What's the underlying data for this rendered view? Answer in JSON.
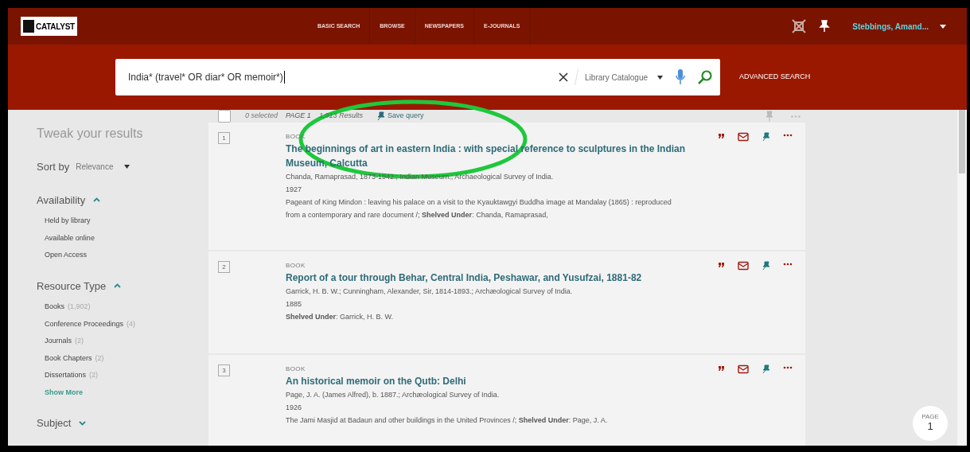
{
  "header": {
    "logo": "CATALYST",
    "nav": [
      {
        "label": "BASIC SEARCH",
        "selected": false
      },
      {
        "label": "BROWSE",
        "selected": false
      },
      {
        "label": "NEWSPAPERS",
        "selected": false
      },
      {
        "label": "E-JOURNALS",
        "selected": false
      }
    ],
    "user": "Stebbings, Amand..."
  },
  "search": {
    "value": "India* (travel* OR diar* OR memoir*)",
    "scope": "Library Catalogue",
    "advanced": "ADVANCED SEARCH"
  },
  "sidebar": {
    "title": "Tweak your results",
    "sort_label": "Sort by",
    "sort_value": "Relevance",
    "facets": [
      {
        "title": "Availability",
        "expanded": true,
        "items": [
          {
            "label": "Held by library"
          },
          {
            "label": "Available online"
          },
          {
            "label": "Open Access"
          }
        ]
      },
      {
        "title": "Resource Type",
        "expanded": true,
        "items": [
          {
            "label": "Books",
            "count": "(1,902)"
          },
          {
            "label": "Conference Proceedings",
            "count": "(4)"
          },
          {
            "label": "Journals",
            "count": "(2)"
          },
          {
            "label": "Book Chapters",
            "count": "(2)"
          },
          {
            "label": "Dissertations",
            "count": "(2)"
          }
        ],
        "show_more": "Show More"
      },
      {
        "title": "Subject",
        "expanded": false
      }
    ]
  },
  "toolbar": {
    "checked": false,
    "selected_label": "0 selected",
    "page_label": "PAGE 1",
    "results_count": "1,913 Results",
    "save_query": "Save query"
  },
  "results": [
    {
      "number": "1",
      "type": "BOOK",
      "title": "The beginnings of art in eastern India : with special reference to sculptures in the Indian Museum, Calcutta",
      "details": [
        "Chanda, Ramaprasad, 1873-1942.; Indian Museum.; Archaeological Survey of India.",
        "1927",
        "Pageant of King Mindon : leaving his palace on a visit to the Kyauktawgyi Buddha image at Mandalay (1865) : reproduced from a contemporary and rare document /; **Shelved Under**: Chanda, Ramaprasad,"
      ]
    },
    {
      "number": "2",
      "type": "BOOK",
      "title": "Report of a tour through Behar, Central India, Peshawar, and Yusufzai, 1881-82",
      "details": [
        "Garrick, H. B. W.; Cunningham, Alexander, Sir, 1814-1893.; Archæological Survey of India.",
        "1885",
        "**Shelved Under**: Garrick, H. B. W."
      ]
    },
    {
      "number": "3",
      "type": "BOOK",
      "title": "An historical memoir on the Qutb: Delhi",
      "details": [
        "Page, J. A. (James Alfred), b. 1887.; Archæological Survey of India.",
        "1926",
        "The Jami Masjid at Badaun and other buildings in the United Provinces /; **Shelved Under**: Page, J. A."
      ]
    }
  ],
  "page_indicator": {
    "label": "PAGE",
    "number": "1"
  }
}
